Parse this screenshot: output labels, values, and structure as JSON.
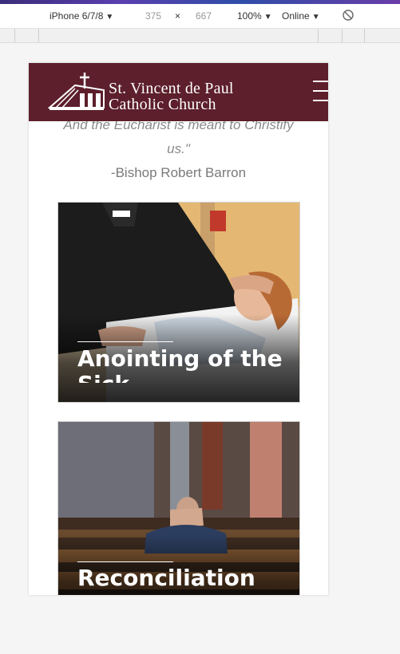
{
  "devtools": {
    "device": "iPhone 6/7/8",
    "width": "375",
    "times": "×",
    "height": "667",
    "zoom": "100%",
    "network": "Online",
    "rotate_icon": "rotate-icon"
  },
  "site": {
    "logo_line1": "St. Vincent de Paul",
    "logo_line2": "Catholic Church",
    "brand_color": "#5c1f2b"
  },
  "quote": {
    "line1": "And the Eucharist is meant to Christify",
    "line2": "us.\"",
    "attribution": "-Bishop Robert Barron"
  },
  "cards": [
    {
      "title": "Anointing of the Sick"
    },
    {
      "title": "Reconciliation"
    }
  ]
}
